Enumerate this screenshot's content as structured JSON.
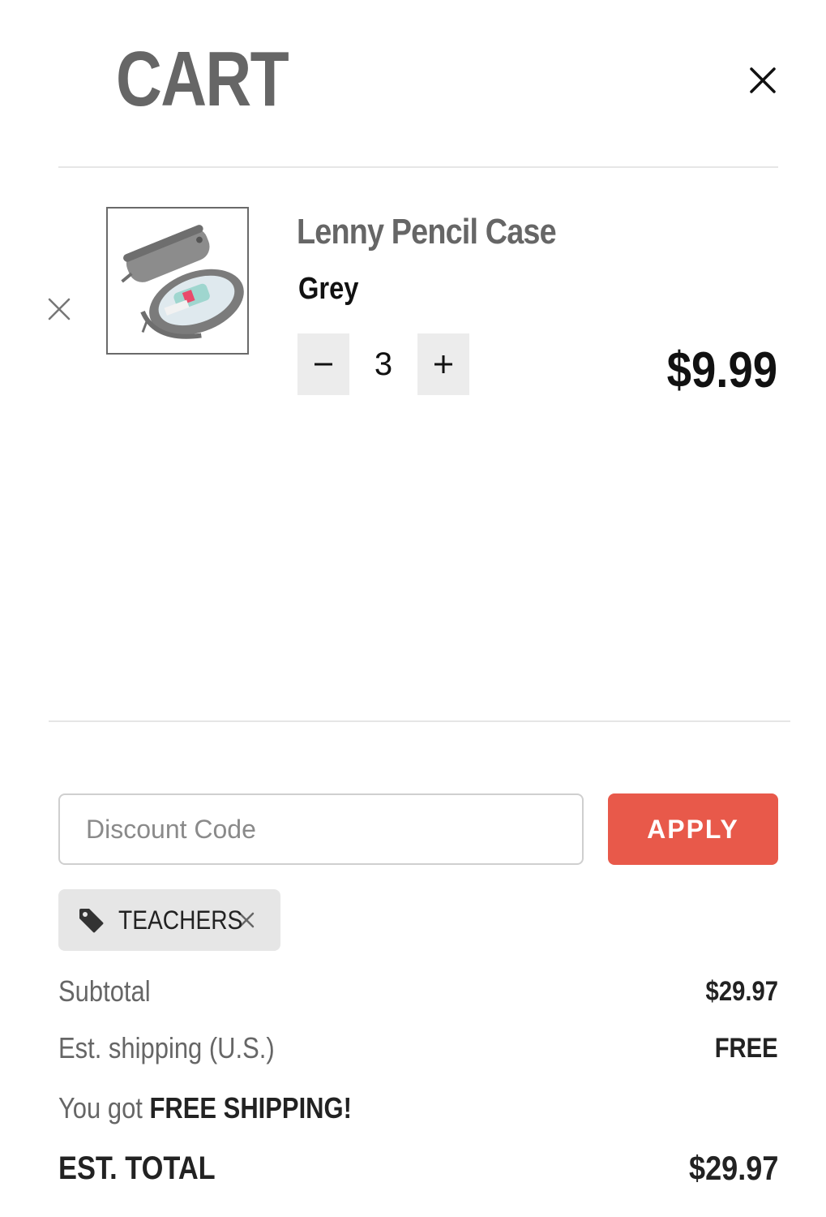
{
  "header": {
    "title": "CART",
    "close_icon": "close-icon"
  },
  "item": {
    "remove_icon": "close-icon",
    "image_icon": "pencil-case-image",
    "name": "Lenny Pencil Case",
    "variant": "Grey",
    "quantity": "3",
    "minus_icon": "minus-icon",
    "plus_icon": "plus-icon",
    "price": "$9.99"
  },
  "discount": {
    "placeholder": "Discount Code",
    "value": "",
    "apply_label": "APPLY",
    "apply_color": "#e8594a",
    "applied_code": "TEACHERS",
    "tag_icon": "tag-icon"
  },
  "summary": {
    "subtotal_label": "Subtotal",
    "subtotal_value": "$29.97",
    "shipping_label": "Est. shipping (U.S.)",
    "shipping_value": "FREE",
    "free_ship_prefix": "You got ",
    "free_ship_emphasis": "FREE SHIPPING!",
    "total_label": "EST. TOTAL",
    "total_value": "$29.97"
  }
}
